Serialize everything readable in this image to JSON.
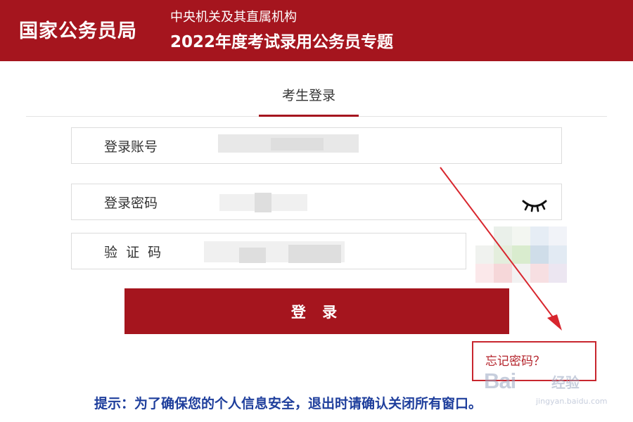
{
  "header": {
    "site_name": "国家公务员局",
    "subtitle_line1": "中央机关及其直属机构",
    "subtitle_line2": "2022年度考试录用公务员专题"
  },
  "tabs": [
    {
      "label": "考生登录",
      "active": true
    }
  ],
  "form": {
    "account": {
      "label": "登录账号",
      "value": ""
    },
    "password": {
      "label": "登录密码",
      "value": "",
      "toggle_icon": "eye-closed-icon"
    },
    "captcha": {
      "label": "验  证  码",
      "value": ""
    },
    "login_button": "登 录",
    "forgot_password": "忘记密码？"
  },
  "hint": "提示：为了确保您的个人信息安全，退出时请确认关闭所有窗口。",
  "watermark": {
    "logo": "Bai",
    "logo_suffix": "经验",
    "url": "jingyan.baidu.com"
  },
  "colors": {
    "brand_red": "#a5151e",
    "hint_blue": "#1e3e9c",
    "annotation_red": "#d8262e"
  }
}
